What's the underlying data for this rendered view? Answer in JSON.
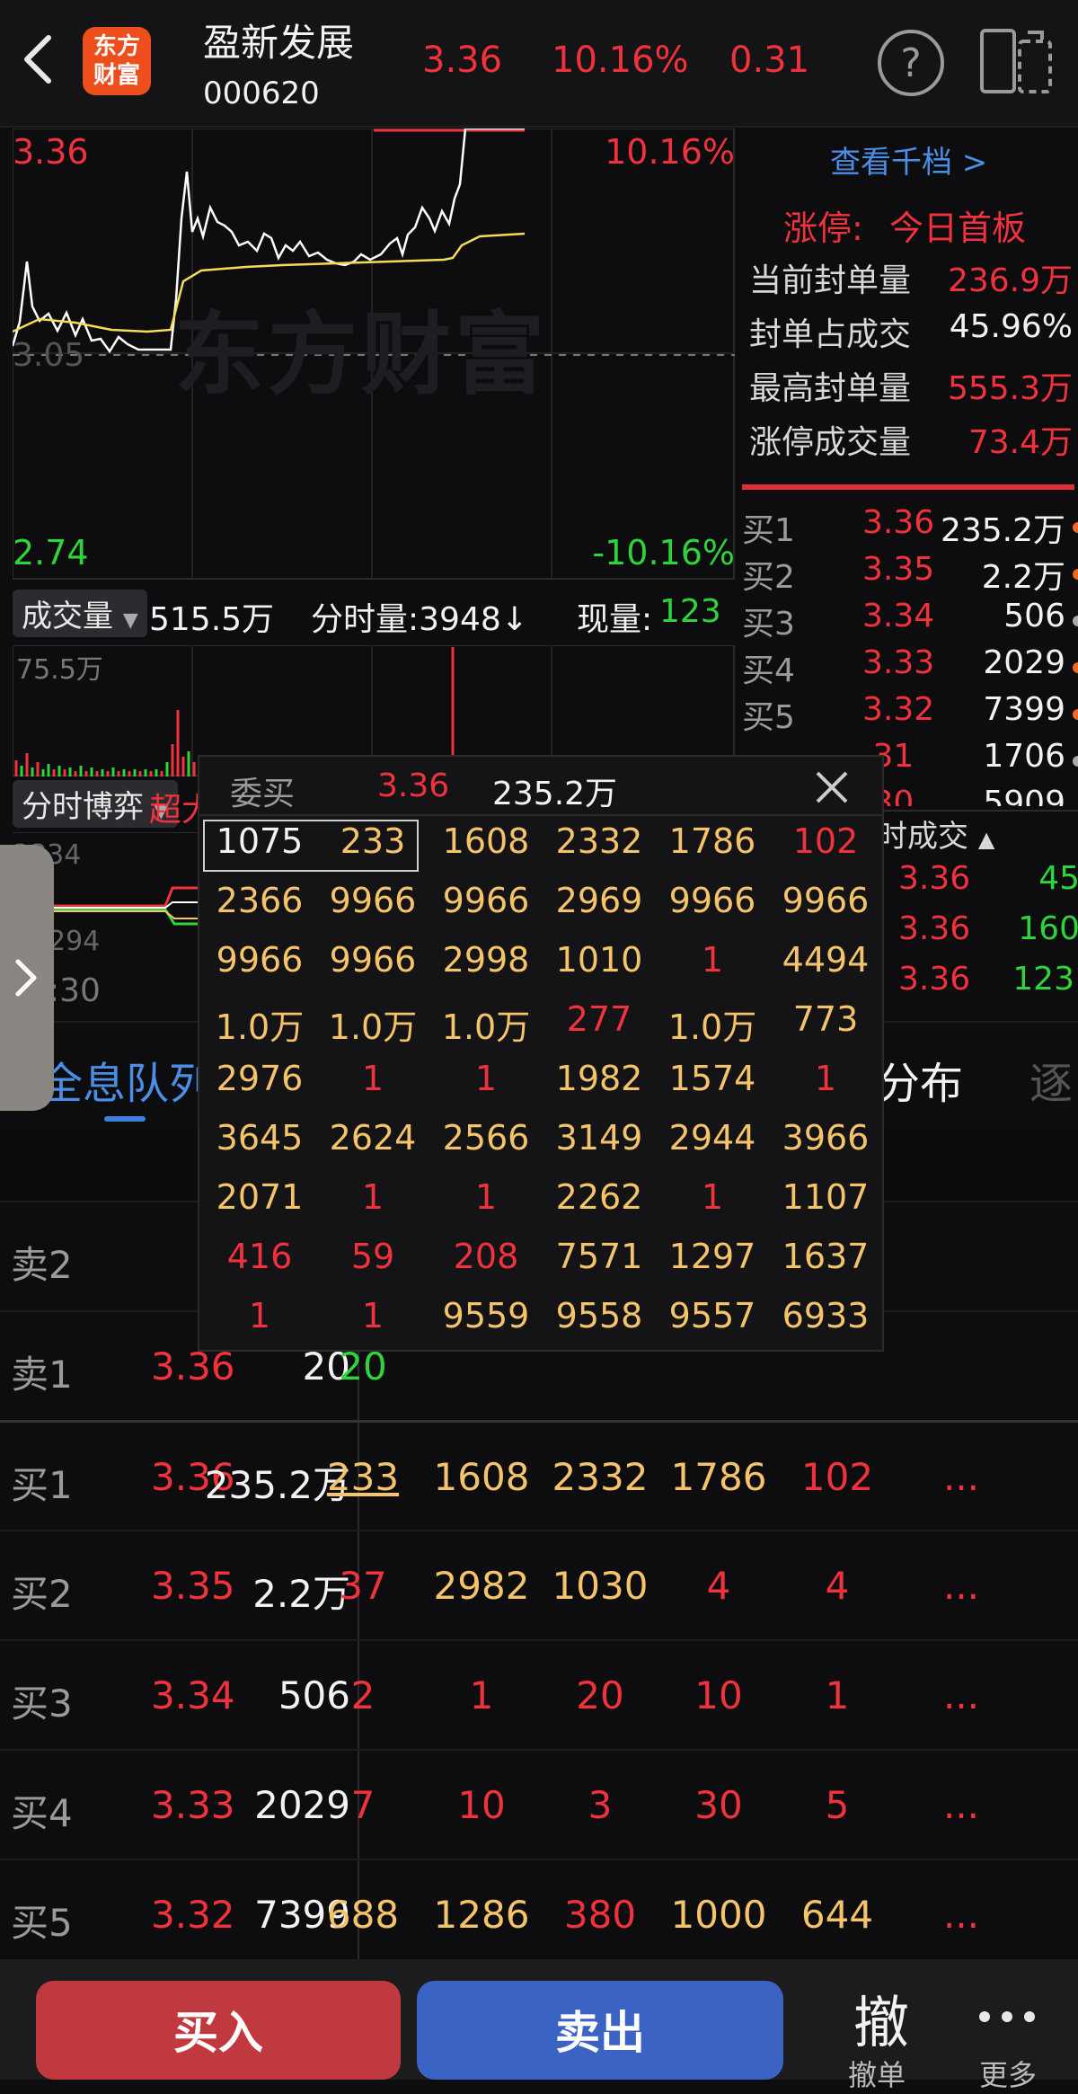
{
  "header": {
    "logo_line1": "东方",
    "logo_line2": "财富",
    "stock_name": "盈新发展",
    "stock_code": "000620",
    "price": "3.36",
    "change_pct": "10.16%",
    "change_amt": "0.31"
  },
  "chart": {
    "top_price": "3.36",
    "top_pct": "10.16%",
    "mid_price": "3.05",
    "bottom_price": "2.74",
    "bottom_pct": "-10.16%",
    "watermark": "东方财富"
  },
  "volume_bar": {
    "tag": "成交量",
    "total": "515.5万",
    "minute_vol": "分时量:3948↓",
    "cur_label": "现量:",
    "cur_value": "123",
    "max_label": "75.5万"
  },
  "game_bar": {
    "tag": "分时博弈",
    "label_partial": "超大",
    "val1": "3334",
    "val2": "294",
    "time": ":30"
  },
  "right_panel": {
    "view_link": "查看千档 >",
    "limit_label": "涨停:",
    "limit_value": "今日首板",
    "stats": [
      {
        "label": "当前封单量",
        "value": "236.9万"
      },
      {
        "label": "封单占成交",
        "value": "45.96%"
      },
      {
        "label": "最高封单量",
        "value": "555.3万"
      },
      {
        "label": "涨停成交量",
        "value": "73.4万"
      }
    ],
    "orderbook": [
      {
        "label": "买1",
        "price": "3.36",
        "qty": "235.2万"
      },
      {
        "label": "买2",
        "price": "3.35",
        "qty": "2.2万"
      },
      {
        "label": "买3",
        "price": "3.34",
        "qty": "506"
      },
      {
        "label": "买4",
        "price": "3.33",
        "qty": "2029"
      },
      {
        "label": "买5",
        "price": "3.32",
        "qty": "7399"
      },
      {
        "label": "",
        "price": ".31",
        "qty": "1706"
      },
      {
        "label": "",
        "price": ".30",
        "qty": "5909"
      }
    ],
    "trades_title": "时成交",
    "trades": [
      {
        "price": "3.36",
        "vol": "45"
      },
      {
        "price": "3.36",
        "vol": "160"
      },
      {
        "price": "3.36",
        "vol": "123"
      }
    ]
  },
  "tabs": {
    "left_partial": "全息队列",
    "right_partial": "分布",
    "far_right_partial": "逐"
  },
  "popup": {
    "title": "委买",
    "price": "3.36",
    "qty": "235.2万",
    "grid": [
      [
        "1075",
        "233",
        "1608",
        "2332",
        "1786",
        "102"
      ],
      [
        "2366",
        "9966",
        "9966",
        "2969",
        "9966",
        "9966"
      ],
      [
        "9966",
        "9966",
        "2998",
        "1010",
        "1",
        "4494"
      ],
      [
        "1.0万",
        "1.0万",
        "1.0万",
        "277",
        "1.0万",
        "773"
      ],
      [
        "2976",
        "1",
        "1",
        "1982",
        "1574",
        "1"
      ],
      [
        "3645",
        "2624",
        "2566",
        "3149",
        "2944",
        "3966"
      ],
      [
        "2071",
        "1",
        "1",
        "2262",
        "1",
        "1107"
      ],
      [
        "416",
        "59",
        "208",
        "7571",
        "1297",
        "1637"
      ],
      [
        "1",
        "1",
        "9559",
        "9558",
        "9557",
        "6933"
      ]
    ],
    "grid_colors": [
      [
        "w",
        "y",
        "y",
        "y",
        "y",
        "r"
      ],
      [
        "y",
        "y",
        "y",
        "y",
        "y",
        "y"
      ],
      [
        "y",
        "y",
        "y",
        "y",
        "r",
        "y"
      ],
      [
        "y",
        "y",
        "y",
        "r",
        "y",
        "y"
      ],
      [
        "y",
        "r",
        "r",
        "y",
        "y",
        "r"
      ],
      [
        "y",
        "y",
        "y",
        "y",
        "y",
        "y"
      ],
      [
        "y",
        "r",
        "r",
        "y",
        "r",
        "y"
      ],
      [
        "r",
        "r",
        "r",
        "y",
        "y",
        "y"
      ],
      [
        "r",
        "r",
        "y",
        "y",
        "y",
        "y"
      ]
    ]
  },
  "levels": [
    {
      "label": "卖2",
      "price": "",
      "qty": "",
      "queue": []
    },
    {
      "label": "卖1",
      "price": "3.36",
      "qty": "20",
      "queue": [
        "20"
      ]
    },
    {
      "label": "买1",
      "price": "3.36",
      "qty": "235.2万",
      "queue": [
        "233",
        "1608",
        "2332",
        "1786",
        "102",
        "..."
      ]
    },
    {
      "label": "买2",
      "price": "3.35",
      "qty": "2.2万",
      "queue": [
        "37",
        "2982",
        "1030",
        "4",
        "4",
        "..."
      ]
    },
    {
      "label": "买3",
      "price": "3.34",
      "qty": "506",
      "queue": [
        "2",
        "1",
        "20",
        "10",
        "1",
        "..."
      ]
    },
    {
      "label": "买4",
      "price": "3.33",
      "qty": "2029",
      "queue": [
        "7",
        "10",
        "3",
        "30",
        "5",
        "..."
      ]
    },
    {
      "label": "买5",
      "price": "3.32",
      "qty": "7399",
      "queue": [
        "688",
        "1286",
        "380",
        "1000",
        "644",
        "..."
      ]
    }
  ],
  "level_colors": [
    [],
    [
      "g"
    ],
    [
      "y",
      "y",
      "y",
      "y",
      "r",
      "r"
    ],
    [
      "r",
      "y",
      "y",
      "r",
      "r",
      "r"
    ],
    [
      "r",
      "r",
      "r",
      "r",
      "r",
      "r"
    ],
    [
      "r",
      "r",
      "r",
      "r",
      "r",
      "r"
    ],
    [
      "y",
      "y",
      "r",
      "y",
      "y",
      "r"
    ]
  ],
  "bottom": {
    "buy": "买入",
    "sell": "卖出",
    "cancel_icon": "撤",
    "cancel_label": "撤单",
    "more_label": "更多"
  },
  "colors": {
    "red": "#f0323c",
    "green": "#2fd43a",
    "yellow": "#f5c46a",
    "buy_btn": "#c0393e",
    "sell_btn": "#3a63c4"
  }
}
